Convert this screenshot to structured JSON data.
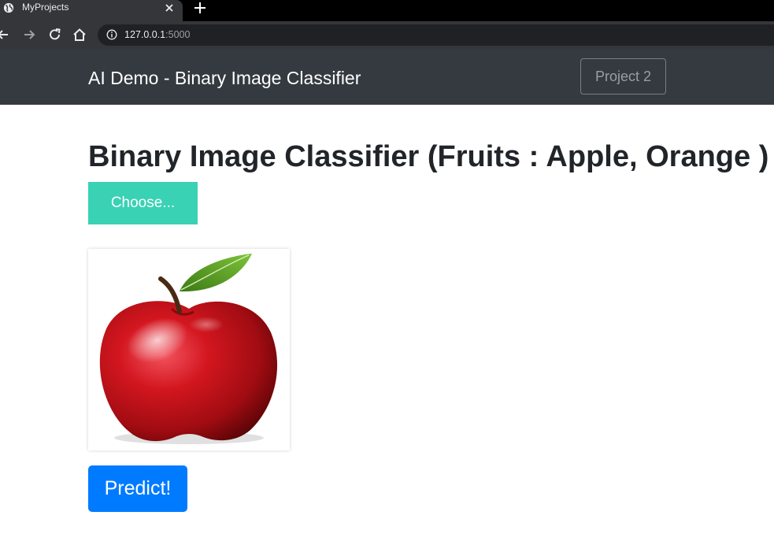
{
  "browser": {
    "tab_title": "MyProjects",
    "url_host": "127.0.0.1",
    "url_port": ":5000"
  },
  "navbar": {
    "brand": "AI Demo - Binary Image Classifier",
    "project_button": "Project 2"
  },
  "main": {
    "title": "Binary Image Classifier (Fruits : Apple, Orange )",
    "choose_label": "Choose...",
    "preview_image": "apple-photo",
    "predict_label": "Predict!"
  },
  "colors": {
    "navbar_bg": "#343a40",
    "choose_button": "#39d2b4",
    "predict_button": "#007bff",
    "title_text": "#212529"
  }
}
